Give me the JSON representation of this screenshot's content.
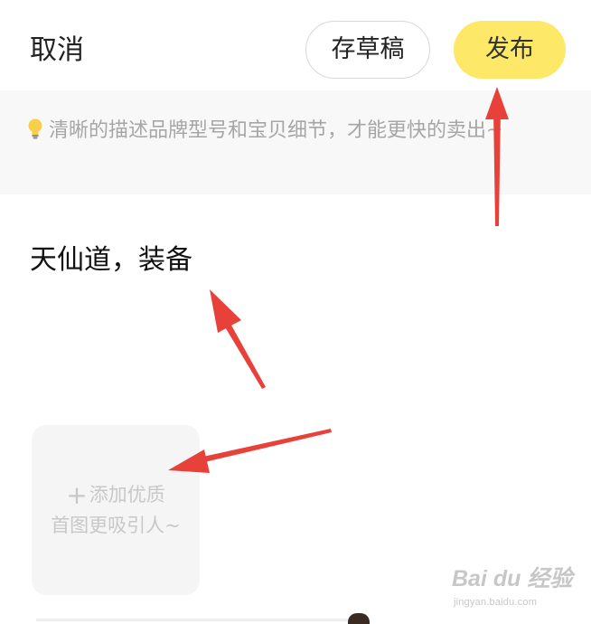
{
  "header": {
    "cancel_label": "取消",
    "draft_label": "存草稿",
    "publish_label": "发布"
  },
  "tip": {
    "text": "清晰的描述品牌型号和宝贝细节，才能更快的卖出~",
    "icon": "lightbulb-icon"
  },
  "description": {
    "value": "天仙道，装备"
  },
  "add_image": {
    "line1": "添加优质",
    "line2": "首图更吸引人~",
    "icon": "plus-icon"
  },
  "watermark": {
    "logo": "Bai du 经验",
    "site": "jingyan.baidu.com"
  },
  "colors": {
    "publish_button": "#fde868",
    "tip_background": "#f8f8f8",
    "annotation_arrow": "#e8413a"
  }
}
